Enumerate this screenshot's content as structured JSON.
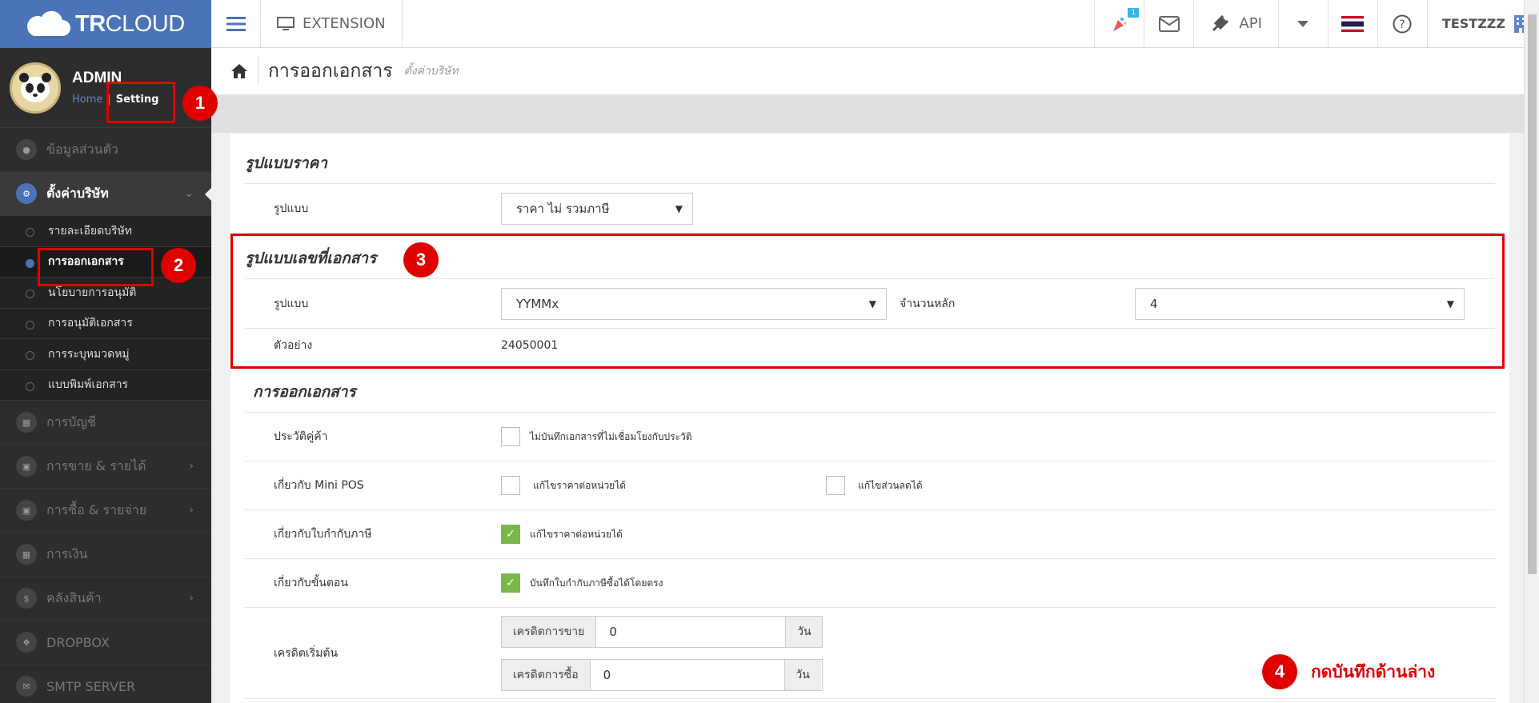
{
  "header": {
    "brand_bold": "TR",
    "brand_light": "CLOUD",
    "extension_label": "EXTENSION",
    "badge_count": "1",
    "api_label": "API",
    "user_label": "TESTZZZ"
  },
  "sidebar": {
    "user_name": "ADMIN",
    "home_link": "Home",
    "setting_link": "Setting",
    "items": [
      {
        "label": "ข้อมูลส่วนตัว"
      },
      {
        "label": "ตั้งค่าบริษัท"
      },
      {
        "label": "การบัญชี"
      },
      {
        "label": "การขาย & รายได้"
      },
      {
        "label": "การซื้อ & รายจ่าย"
      },
      {
        "label": "การเงิน"
      },
      {
        "label": "คลังสินค้า"
      },
      {
        "label": "DROPBOX"
      },
      {
        "label": "SMTP SERVER"
      }
    ],
    "subitems": [
      {
        "label": "รายละเอียดบริษัท"
      },
      {
        "label": "การออกเอกสาร"
      },
      {
        "label": "นโยบายการอนุมัติ"
      },
      {
        "label": "การอนุมัติเอกสาร"
      },
      {
        "label": "การระบุหมวดหมู่"
      },
      {
        "label": "แบบพิมพ์เอกสาร"
      }
    ]
  },
  "breadcrumb": {
    "title": "การออกเอกสาร",
    "subtitle": "ตั้งค่าบริษัท"
  },
  "price_format": {
    "section_title": "รูปแบบราคา",
    "format_label": "รูปแบบ",
    "format_value": "ราคา ไม่ รวมภาษี"
  },
  "doc_number": {
    "section_title": "รูปแบบเลขที่เอกสาร",
    "format_label": "รูปแบบ",
    "format_value": "YYMMx",
    "digits_label": "จำนวนหลัก",
    "digits_value": "4",
    "example_label": "ตัวอย่าง",
    "example_value": "24050001"
  },
  "issuing": {
    "section_title": "การออกเอกสาร",
    "rows": [
      {
        "label": "ประวัติคู่ค้า",
        "opt1": "ไม่บันทึกเอกสารที่ไม่เชื่อมโยงกับประวัติ"
      },
      {
        "label": "เกี่ยวกับ Mini POS",
        "opt1": "แก้ไขราคาต่อหน่วยได้",
        "opt2": "แก้ไขส่วนลดได้"
      },
      {
        "label": "เกี่ยวกับใบกำกับภาษี",
        "opt1": "แก้ไขราคาต่อหน่วยได้"
      },
      {
        "label": "เกี่ยวกับขั้นตอน",
        "opt1": "บันทึกใบกำกับภาษีซื้อได้โดยตรง"
      }
    ],
    "credit_label": "เครดิตเริ่มต้น",
    "sale_credit_label": "เครดิตการขาย",
    "sale_credit_value": "0",
    "purchase_credit_label": "เครดิตการซื้อ",
    "purchase_credit_value": "0",
    "unit": "วัน"
  },
  "annotations": {
    "m1": "1",
    "m2": "2",
    "m3": "3",
    "m4": "4",
    "note": "กดบันทึกด้านล่าง"
  },
  "colors": {
    "brand": "#4a73b8",
    "annotation": "#e00000",
    "checked": "#7ab648"
  }
}
